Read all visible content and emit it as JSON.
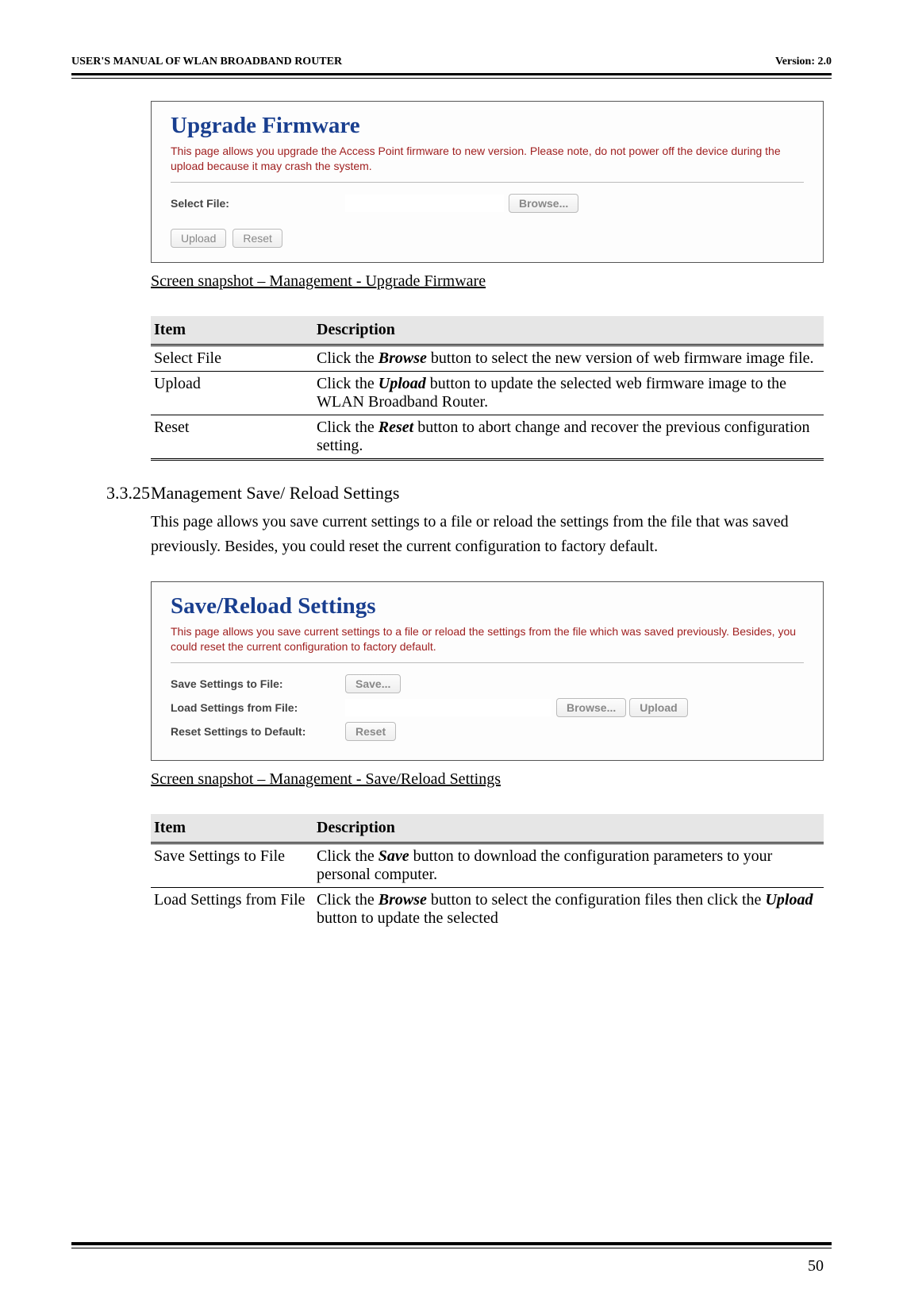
{
  "header": {
    "left": "USER'S MANUAL OF WLAN BROADBAND ROUTER",
    "right": "Version: 2.0"
  },
  "panel1": {
    "title": "Upgrade Firmware",
    "note": "This page allows you upgrade the Access Point firmware to new version. Please note, do not power off the device during the upload because it may crash the system.",
    "select_label": "Select File:",
    "browse": "Browse...",
    "upload": "Upload",
    "reset": "Reset"
  },
  "caption1": "Screen snapshot – Management - Upgrade Firmware",
  "table1": {
    "h1": "Item",
    "h2": "Description",
    "rows": [
      {
        "item": "Select File",
        "desc": "Click the <b><i>Browse</i></b> button to select the new version of web firmware image file."
      },
      {
        "item": "Upload",
        "desc": "Click the <b><i>Upload</i></b> button to update the selected web firmware image to the WLAN Broadband Router."
      },
      {
        "item": "Reset",
        "desc": "Click the <b><i>Reset</i></b> button to abort change and recover the previous configuration setting."
      }
    ]
  },
  "section": {
    "num": "3.3.25",
    "title": "Management Save/ Reload Settings",
    "body": "This page allows you save current settings to a file or reload the settings from the file that was saved previously. Besides, you could reset the current configuration to factory default."
  },
  "panel2": {
    "title": "Save/Reload Settings",
    "note": "This page allows you save current settings to a file or reload the settings from the file which was saved previously. Besides, you could reset the current configuration to factory default.",
    "save_label": "Save Settings to File:",
    "load_label": "Load Settings from File:",
    "reset_label": "Reset Settings to Default:",
    "save": "Save...",
    "browse": "Browse...",
    "upload": "Upload",
    "reset": "Reset"
  },
  "caption2": "Screen snapshot – Management - Save/Reload Settings",
  "table2": {
    "h1": "Item",
    "h2": "Description",
    "rows": [
      {
        "item": "Save Settings to File",
        "desc": "Click the <b><i>Save</i></b> button to download the configuration parameters to your personal computer."
      },
      {
        "item": "Load Settings from File",
        "desc": "Click the <b><i>Browse</i></b> button to select the configuration files then click the <b><i>Upload</i></b> button to update the selected"
      }
    ]
  },
  "page_num": "50"
}
